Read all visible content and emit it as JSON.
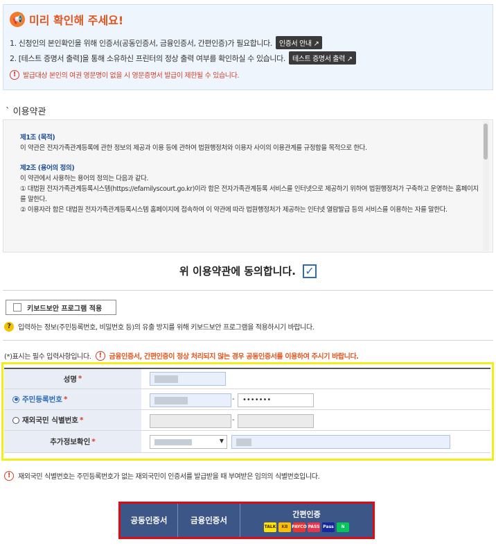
{
  "notice": {
    "title": "미리 확인해 주세요!",
    "icon": "megaphone-icon",
    "line1": "1. 신청인의 본인확인을 위해 인증서(공동인증서, 금융인증서, 간편인증)가 필요합니다.",
    "line1_button": "인증서 안내 ↗",
    "line2": "2. [테스트 증명서 출력]을 통해 소유하신 프린터의 정상 출력 여부를 확인하실 수 있습니다.",
    "line2_button": "테스트 증명서 출력 ↗",
    "warning": "발급대상 본인의 여권 영문명이 없을 시 영문증명서 발급이 제한될 수 있습니다."
  },
  "terms": {
    "section_title": "이용약관",
    "art1_title": "제1조 (목적)",
    "art1_body": "이 약관은 전자가족관계등록에 관한 정보의 제공과 이용 등에 관하여 법원행정처와 이용자 사이의 이용관계를 규정함을 목적으로 한다.",
    "art2_title": "제2조 (용어의 정의)",
    "art2_intro": "이 약관에서 사용하는 용어의 정의는 다음과 같다.",
    "art2_item1": "① 대법원 전자가족관계등록시스템(https://efamilyscourt.go.kr)이라 함은 전자가족관계등록 서비스를 인터넷으로 제공하기 위하여 법원행정처가 구축하고 운영하는 홈페이지를 말한다.",
    "art2_item2": "② 이용자라 함은 대법원 전자가족관계등록시스템 홈페이지에 접속하여 이 약관에 따라 법원행정처가 제공하는 인터넷 열람발급 등의 서비스를 이용하는 자를 말한다.",
    "agree_label": "위 이용약관에 동의합니다.",
    "agree_checked": true
  },
  "keyboard": {
    "button_label": "키보드보안 프로그램 적용",
    "help_text": "입력하는 정보(주민등록번호, 비밀번호 등)의 유출 방지를 위해 키보드보안 프로그램을 적용하시기 바랍니다."
  },
  "required_note": "(*)표시는 필수 입력사항입니다.",
  "required_warning": "금융인증서, 간편인증이 정상 처리되지 않는 경우 공동인증서를 이용하여 주시기 바랍니다.",
  "form": {
    "name_label": "성명",
    "rrn_label": "주민등록번호",
    "rrn_back_value": "•••••••",
    "foreign_label": "재외국민 식별번호",
    "extra_label": "추가정보확인",
    "required_mark": "*",
    "dash": "-",
    "select_arrow": "▼"
  },
  "bottom_note": "재외국민 식별번호는 주민등록번호가 없는 재외국민이 인증서를 발급받을 때 부여받은 임의의 식별번호입니다.",
  "auth": {
    "joint_cert": "공동인증서",
    "financial_cert": "금융인증서",
    "easy_auth": "간편인증",
    "logos": [
      {
        "icon": "kakao-icon",
        "text": "TALK",
        "bg": "#fee500",
        "fg": "#3a1d1d"
      },
      {
        "icon": "kb-icon",
        "text": "KB",
        "bg": "#ffbc00",
        "fg": "#5a4a00"
      },
      {
        "icon": "payco-icon",
        "text": "PAYCO",
        "bg": "#f0312d",
        "fg": "#ffffff"
      },
      {
        "icon": "pass-icon",
        "text": "PASS",
        "bg": "#e8344c",
        "fg": "#ffffff"
      },
      {
        "icon": "samsung-pass-icon",
        "text": "Pass",
        "bg": "#1428a0",
        "fg": "#ffffff"
      },
      {
        "icon": "naver-icon",
        "text": "N",
        "bg": "#03c75a",
        "fg": "#ffffff"
      }
    ]
  },
  "colors": {
    "accent_blue": "#2e6ab8",
    "warning_red": "#d4402b",
    "auth_bar": "#3d5688",
    "highlight_yellow": "#f3ee1a",
    "highlight_red": "#e10a14"
  }
}
